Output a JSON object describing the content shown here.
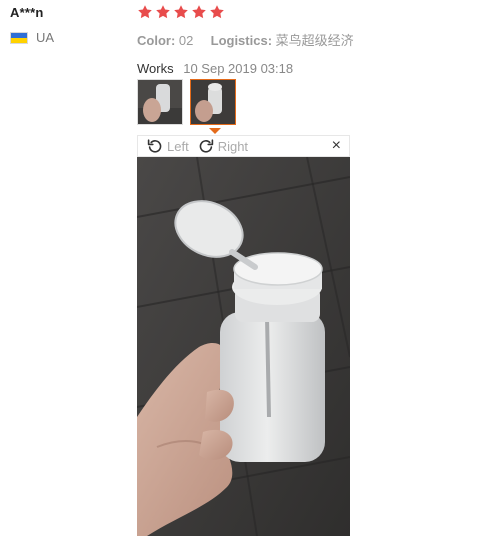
{
  "buyer": {
    "name": "A***n",
    "country": "UA",
    "flag_colors": [
      "#2f6fd6",
      "#ffd200"
    ]
  },
  "review": {
    "rating": 5,
    "rating_max": 5,
    "star_color": "#e84c4c",
    "color_label": "Color:",
    "color_value": "02",
    "logistics_label": "Logistics:",
    "logistics_value": "菜鸟超级经济",
    "text": "Works",
    "date": "10 Sep 2019 03:18"
  },
  "thumbnails": [
    {
      "icon": "bottle-photo-thumbnail",
      "active": false
    },
    {
      "icon": "bottle-photo-thumbnail",
      "active": true
    }
  ],
  "viewer": {
    "rotate_left_label": "Left",
    "rotate_right_label": "Right",
    "rotate_left_icon": "rotate-left-icon",
    "rotate_right_icon": "rotate-right-icon",
    "close_label": "×",
    "accent_color": "#e46b1b"
  }
}
